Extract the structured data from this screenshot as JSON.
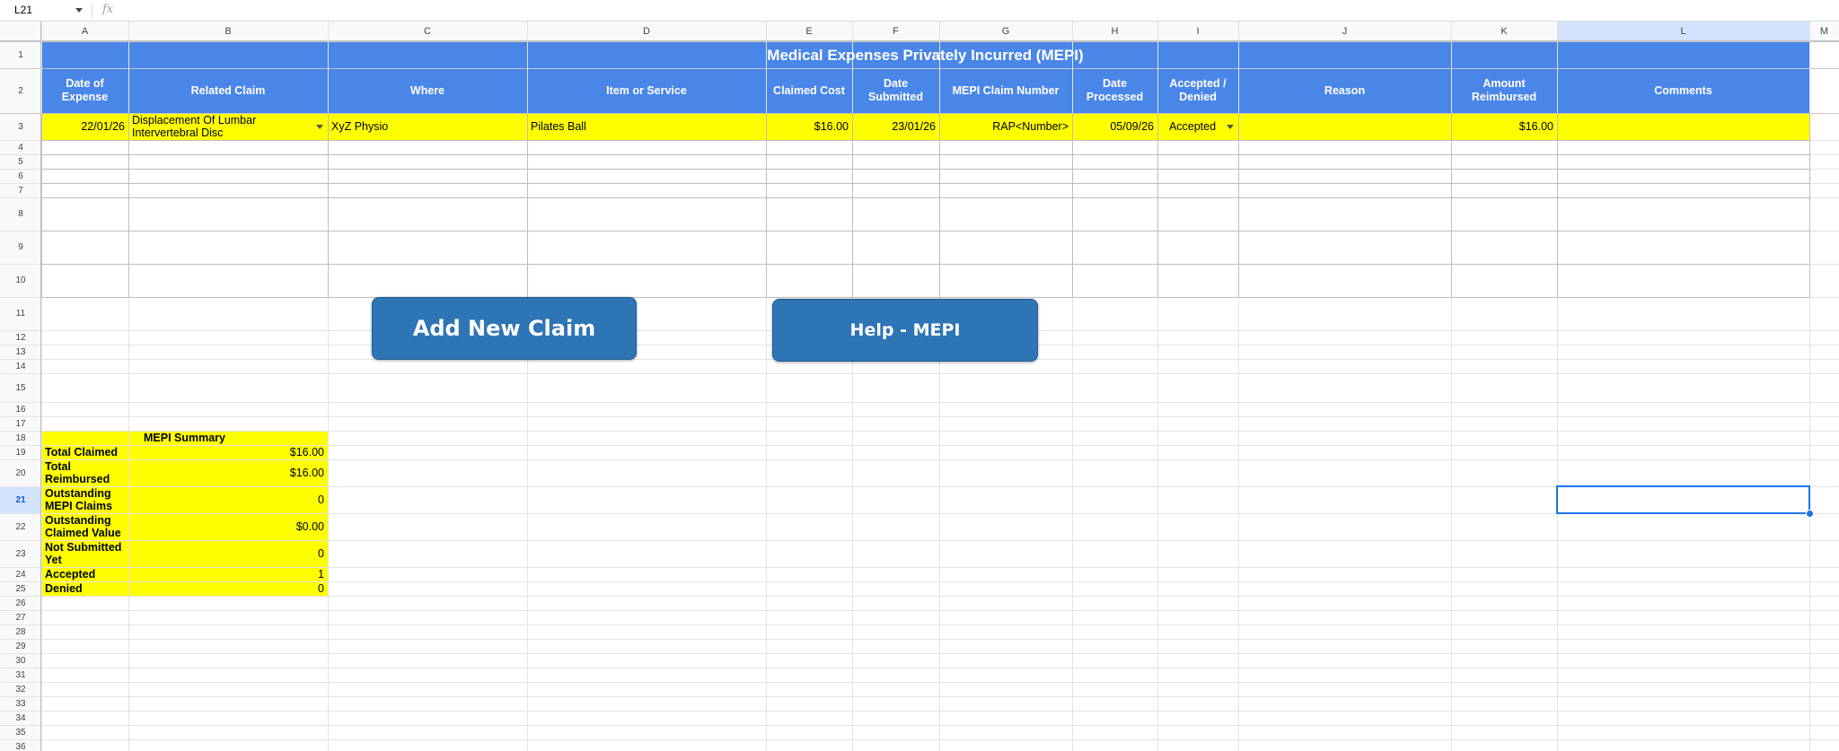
{
  "formula_bar": {
    "name_box": "L21",
    "fx_label": "fx"
  },
  "columns": [
    "A",
    "B",
    "C",
    "D",
    "E",
    "F",
    "G",
    "H",
    "I",
    "J",
    "K",
    "L",
    "M"
  ],
  "rows": [
    "1",
    "2",
    "3",
    "4",
    "5",
    "6",
    "7",
    "8",
    "9",
    "10",
    "11",
    "12",
    "13",
    "14",
    "15",
    "16",
    "17",
    "18",
    "19",
    "20",
    "21",
    "22",
    "23",
    "24",
    "25",
    "26",
    "27",
    "28",
    "29",
    "30",
    "31",
    "32",
    "33",
    "34",
    "35",
    "36"
  ],
  "title": "Medical Expenses Privately Incurred (MEPI)",
  "headers": [
    "Date of Expense",
    "Related Claim",
    "Where",
    "Item or Service",
    "Claimed Cost",
    "Date Submitted",
    "MEPI Claim Number",
    "Date Processed",
    "Accepted / Denied",
    "Reason",
    "Amount Reimbursed",
    "Comments"
  ],
  "record": {
    "date_of_expense": "22/01/26",
    "related_claim": "Displacement Of Lumbar Intervertebral Disc",
    "where": "XyZ Physio",
    "item_or_service": "Pilates Ball",
    "claimed_cost": "$16.00",
    "date_submitted": "23/01/26",
    "claim_number": "RAP<Number>",
    "date_processed": "05/09/26",
    "status": "Accepted",
    "reason": "",
    "amount_reimbursed": "$16.00",
    "comments": ""
  },
  "buttons": {
    "add_new_claim": "Add New Claim",
    "help": "Help - MEPI"
  },
  "summary": {
    "title": "MEPI Summary",
    "rows": [
      {
        "label": "Total Claimed",
        "value": "$16.00"
      },
      {
        "label": "Total Reimbursed",
        "value": "$16.00"
      },
      {
        "label": "Outstanding MEPI Claims",
        "value": "0"
      },
      {
        "label": "Outstanding Claimed Value",
        "value": "$0.00"
      },
      {
        "label": "Not Submitted Yet",
        "value": "0"
      },
      {
        "label": "Accepted",
        "value": "1"
      },
      {
        "label": "Denied",
        "value": "0"
      }
    ]
  },
  "colors": {
    "header_blue": "#4a86e8",
    "highlight_yellow": "#ffff00",
    "button_blue": "#2e75b6",
    "selection": "#1a73e8"
  }
}
